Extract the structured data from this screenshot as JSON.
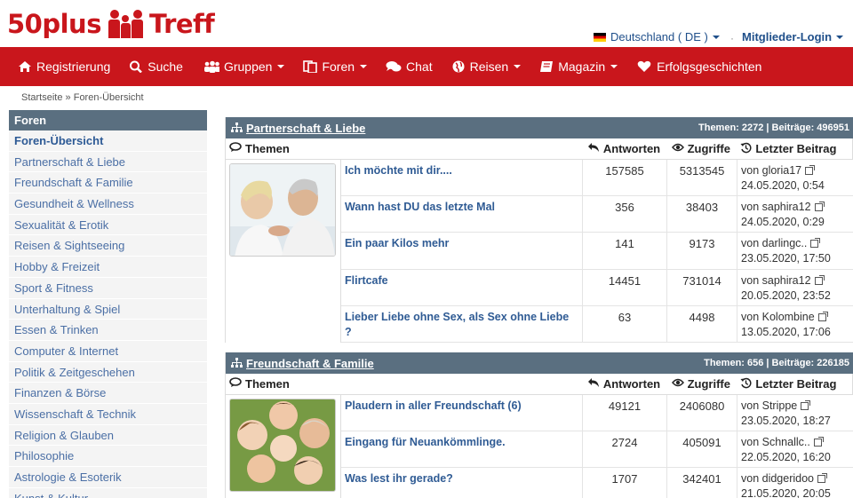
{
  "header": {
    "logo_left": "50plus",
    "logo_right": "Treff",
    "language": "Deutschland ( DE )",
    "login": "Mitglieder-Login"
  },
  "nav": [
    {
      "label": "Registrierung",
      "icon": "home-icon"
    },
    {
      "label": "Suche",
      "icon": "search-icon"
    },
    {
      "label": "Gruppen",
      "icon": "group-icon"
    },
    {
      "label": "Foren",
      "icon": "documents-icon"
    },
    {
      "label": "Chat",
      "icon": "chat-icon"
    },
    {
      "label": "Reisen",
      "icon": "globe-icon"
    },
    {
      "label": "Magazin",
      "icon": "book-icon"
    },
    {
      "label": "Erfolgsgeschichten",
      "icon": "heart-icon"
    }
  ],
  "breadcrumb": {
    "home": "Startseite",
    "sep": "»",
    "current": "Foren-Übersicht"
  },
  "sidebar": {
    "title": "Foren",
    "items": [
      "Foren-Übersicht",
      "Partnerschaft & Liebe",
      "Freundschaft & Familie",
      "Gesundheit & Wellness",
      "Sexualität & Erotik",
      "Reisen & Sightseeing",
      "Hobby & Freizeit",
      "Sport & Fitness",
      "Unterhaltung & Spiel",
      "Essen & Trinken",
      "Computer & Internet",
      "Politik & Zeitgeschehen",
      "Finanzen & Börse",
      "Wissenschaft & Technik",
      "Religion & Glauben",
      "Philosophie",
      "Astrologie & Esoterik",
      "Kunst & Kultur"
    ]
  },
  "columns": {
    "topics": "Themen",
    "answers": "Antworten",
    "views": "Zugriffe",
    "last": "Letzter Beitrag"
  },
  "forums": [
    {
      "title": "Partnerschaft & Liebe",
      "stats": "Themen: 2272 | Beiträge: 496951",
      "topics": [
        {
          "title": "Ich möchte mit dir....",
          "answers": "157585",
          "views": "5313545",
          "by": "von gloria17",
          "date": "24.05.2020, 0:54"
        },
        {
          "title": "Wann hast DU das letzte Mal",
          "answers": "356",
          "views": "38403",
          "by": "von saphira12",
          "date": "24.05.2020, 0:29"
        },
        {
          "title": "Ein paar Kilos mehr",
          "answers": "141",
          "views": "9173",
          "by": "von darlingc..",
          "date": "23.05.2020, 17:50"
        },
        {
          "title": "Flirtcafe",
          "answers": "14451",
          "views": "731014",
          "by": "von saphira12",
          "date": "20.05.2020, 23:52"
        },
        {
          "title": "Lieber Liebe ohne Sex, als Sex ohne Liebe ?",
          "answers": "63",
          "views": "4498",
          "by": "von Kolombine",
          "date": "13.05.2020, 17:06"
        }
      ]
    },
    {
      "title": "Freundschaft & Familie",
      "stats": "Themen: 656 | Beiträge: 226185",
      "topics": [
        {
          "title": "Plaudern in aller Freundschaft (6)",
          "answers": "49121",
          "views": "2406080",
          "by": "von Strippe",
          "date": "23.05.2020, 18:27"
        },
        {
          "title": "Eingang für Neuankömmlinge.",
          "answers": "2724",
          "views": "405091",
          "by": "von Schnallc..",
          "date": "22.05.2020, 16:20"
        },
        {
          "title": "Was lest ihr gerade?",
          "answers": "1707",
          "views": "342401",
          "by": "von didgeridoo",
          "date": "21.05.2020, 20:05"
        }
      ]
    }
  ]
}
